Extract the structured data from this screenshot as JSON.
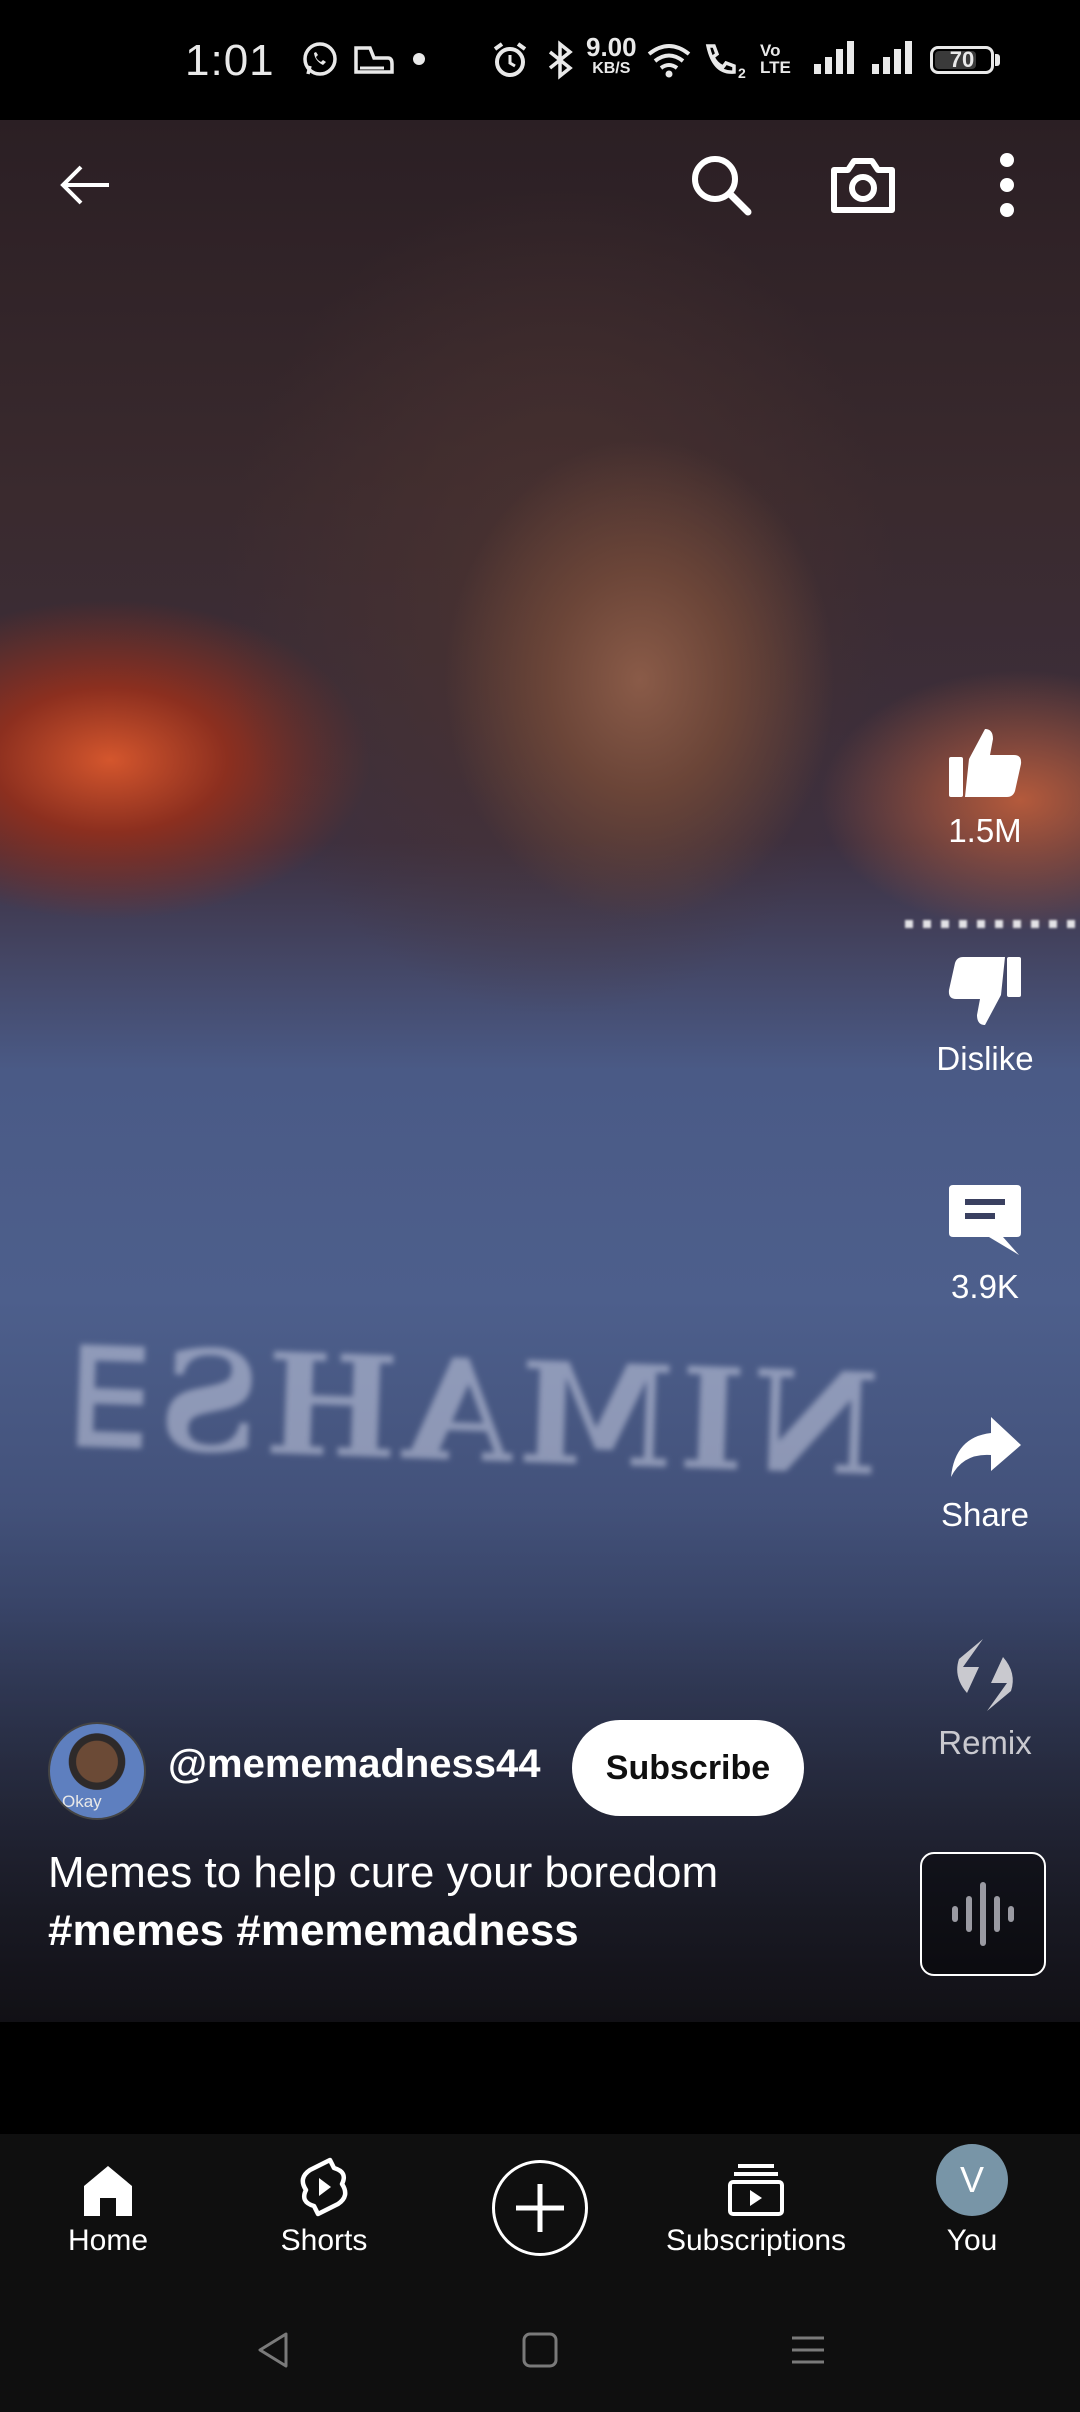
{
  "status_bar": {
    "time": "1:01",
    "net_speed_value": "9.00",
    "net_speed_unit": "KB/S",
    "volte_top": "Vo",
    "volte_bottom": "LTE",
    "call_sim": "2",
    "battery": "70",
    "battery_level": 0.7,
    "icons": [
      "whatsapp-icon",
      "gamepad-icon",
      "dot-icon",
      "alarm-icon",
      "bluetooth-icon",
      "wifi-icon",
      "wifi-call-icon",
      "signal-icon",
      "signal-icon",
      "battery-icon"
    ]
  },
  "video": {
    "shirt_text": "NIMAHS∃"
  },
  "top_bar": {
    "icons": [
      "back-arrow-icon",
      "search-icon",
      "camera-icon",
      "more-vert-icon"
    ]
  },
  "actions": {
    "like_count": "1.5M",
    "dislike_label": "Dislike",
    "comment_count": "3.9K",
    "share_label": "Share",
    "remix_label": "Remix"
  },
  "channel": {
    "handle": "@mememadness44",
    "avatar_caption": "Okay",
    "subscribe_label": "Subscribe"
  },
  "caption": {
    "text": "Memes to help cure your boredom",
    "hashtags": "#memes #mememadness"
  },
  "bottom_nav": {
    "items": [
      {
        "label": "Home",
        "icon": "home-icon"
      },
      {
        "label": "Shorts",
        "icon": "shorts-icon"
      },
      {
        "label": "",
        "icon": "create-plus-icon"
      },
      {
        "label": "Subscriptions",
        "icon": "subscriptions-icon"
      },
      {
        "label": "You",
        "icon": "avatar"
      }
    ],
    "you_initial": "V"
  },
  "colors": {
    "subscribe_bg": "#ffffff",
    "nav_bg": "#0f0f0f",
    "you_avatar": "#7895a7"
  }
}
